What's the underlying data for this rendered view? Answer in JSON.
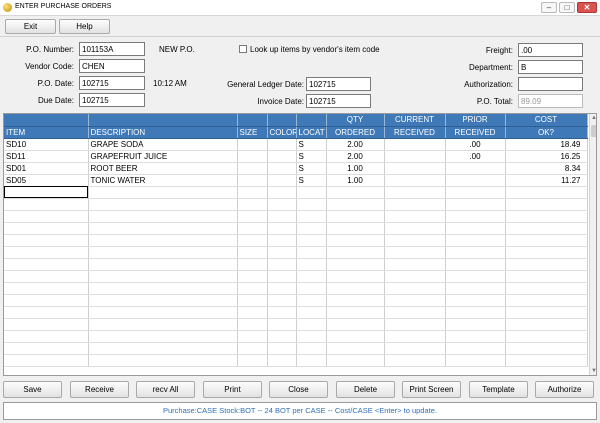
{
  "window": {
    "title": "ENTER PURCHASE ORDERS",
    "min_glyph": "–",
    "max_glyph": "□",
    "close_glyph": "✕"
  },
  "toolbar": {
    "exit_label": "Exit",
    "help_label": "Help"
  },
  "header": {
    "po_number_label": "P.O. Number:",
    "po_number": "101153A",
    "po_status": "NEW P.O.",
    "vendor_code_label": "Vendor Code:",
    "vendor_code": "CHEN",
    "po_date_label": "P.O. Date:",
    "po_date": "102715",
    "po_time": "10:12 AM",
    "due_date_label": "Due Date:",
    "due_date": "102715",
    "lookup_label": "Look up items by vendor's item code",
    "lookup_checked": false,
    "gl_date_label": "General Ledger Date:",
    "gl_date": "102715",
    "invoice_date_label": "Invoice Date:",
    "invoice_date": "102715",
    "freight_label": "Freight:",
    "freight": ".00",
    "department_label": "Department:",
    "department": "B",
    "authorization_label": "Authorization:",
    "authorization": "",
    "po_total_label": "P.O. Total:",
    "po_total": "89.09"
  },
  "grid": {
    "header_top": [
      "",
      "",
      "",
      "",
      "",
      "QTY",
      "CURRENT",
      "PRIOR",
      "COST"
    ],
    "header_bottom": [
      "ITEM",
      "DESCRIPTION",
      "SIZE",
      "COLOR",
      "LOCAT",
      "ORDERED",
      "RECEIVED",
      "RECEIVED",
      "OK?"
    ],
    "rows": [
      {
        "item": "SD10",
        "description": "GRAPE SODA",
        "size": "",
        "color": "",
        "locat": "S",
        "ordered": "2.00",
        "received": "",
        "prior": ".00",
        "cost": "18.49"
      },
      {
        "item": "SD11",
        "description": "GRAPEFRUIT  JUICE",
        "size": "",
        "color": "",
        "locat": "S",
        "ordered": "2.00",
        "received": "",
        "prior": ".00",
        "cost": "16.25"
      },
      {
        "item": "SD01",
        "description": "ROOT BEER",
        "size": "",
        "color": "",
        "locat": "S",
        "ordered": "1.00",
        "received": "",
        "prior": "",
        "cost": "8.34"
      },
      {
        "item": "SD05",
        "description": "TONIC WATER",
        "size": "",
        "color": "",
        "locat": "S",
        "ordered": "1.00",
        "received": "",
        "prior": "",
        "cost": "11.27"
      }
    ]
  },
  "buttons": {
    "save": "Save",
    "receive": "Receive",
    "recv_all": "recv All",
    "print": "Print",
    "close": "Close",
    "delete": "Delete",
    "print_screen": "Print Screen",
    "template": "Template",
    "authorize": "Authorize"
  },
  "status_text": "Purchase:CASE  Stock:BOT  --  24 BOT per CASE -- Cost/CASE <Enter> to update."
}
